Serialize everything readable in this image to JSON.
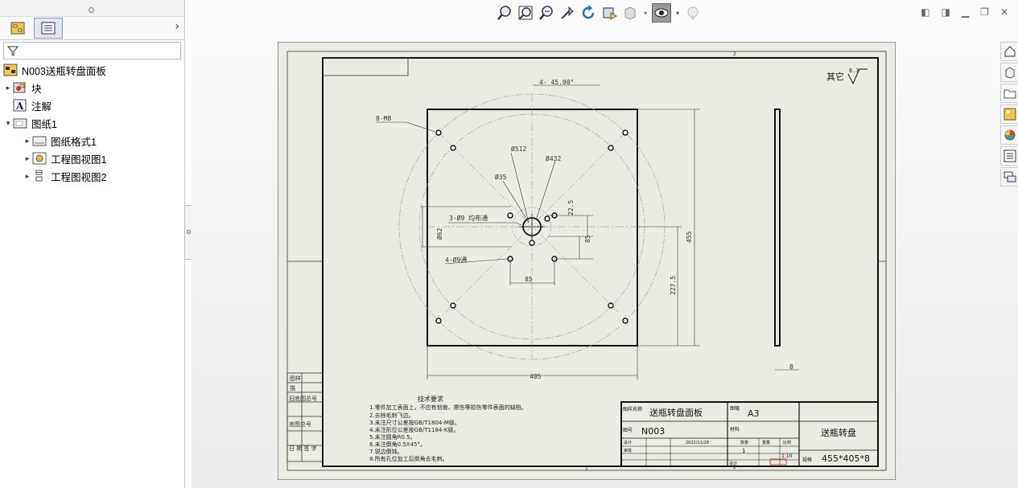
{
  "tree": {
    "root": "N003送瓶转盘面板",
    "items": [
      {
        "label": "块",
        "level": 1,
        "expander": "▸"
      },
      {
        "label": "注解",
        "level": 1,
        "expander": ""
      },
      {
        "label": "图纸1",
        "level": 1,
        "expander": "▾"
      },
      {
        "label": "图纸格式1",
        "level": 2,
        "expander": "▸"
      },
      {
        "label": "工程图视图1",
        "level": 2,
        "expander": "▸"
      },
      {
        "label": "工程图视图2",
        "level": 2,
        "expander": "▸"
      }
    ]
  },
  "drawing": {
    "roughness": "其它",
    "roughness_value": "6.3",
    "dims": {
      "angle": "4- 45.00°",
      "bolt8": "8-M8",
      "d512": "Ø512",
      "d432": "Ø432",
      "d35": "Ø35",
      "holes3": "3-Ø9 均布通",
      "d62": "Ø62",
      "holes4": "4-Ø9通",
      "d22": "22.5",
      "d85v": "85",
      "d85h": "85",
      "d455": "455",
      "d227": "227.5",
      "d405": "405",
      "d8": "8"
    },
    "tech_title": "技术要求",
    "tech_lines": [
      "1.零件加工表面上，不应有划痕、擦伤等损伤零件表面的缺陷。",
      "2.去除毛刺飞边。",
      "3.未注尺寸公差按GB/T1804-M级。",
      "4.未注形位公差按GB/T1184-K级。",
      "5.未注圆角R0.5。",
      "6.未注倒角0.5X45°。",
      "7.锐边倒钝。",
      "8.所有孔位加工后倒角去毛刺。"
    ],
    "left_block": [
      "图样",
      "描",
      "旧底图总号",
      "底图总号",
      "日 期 签 字"
    ],
    "title_block": {
      "drawing_label": "图样名称",
      "drawing_name": "送瓶转盘面板",
      "size_label": "图幅",
      "size": "A3",
      "no_label": "图号",
      "no": "N003",
      "mat_label": "材料",
      "part_name": "送瓶转盘",
      "date": "2022/11/28",
      "qty": "1",
      "scale": "1:10",
      "spec_label": "规格",
      "spec": "455*405*8",
      "zone_label": "设计",
      "col_labels": [
        "设计",
        "审核",
        "数量",
        "重量",
        "比例"
      ]
    },
    "sheet_marks": [
      "2",
      "3",
      "2"
    ]
  }
}
